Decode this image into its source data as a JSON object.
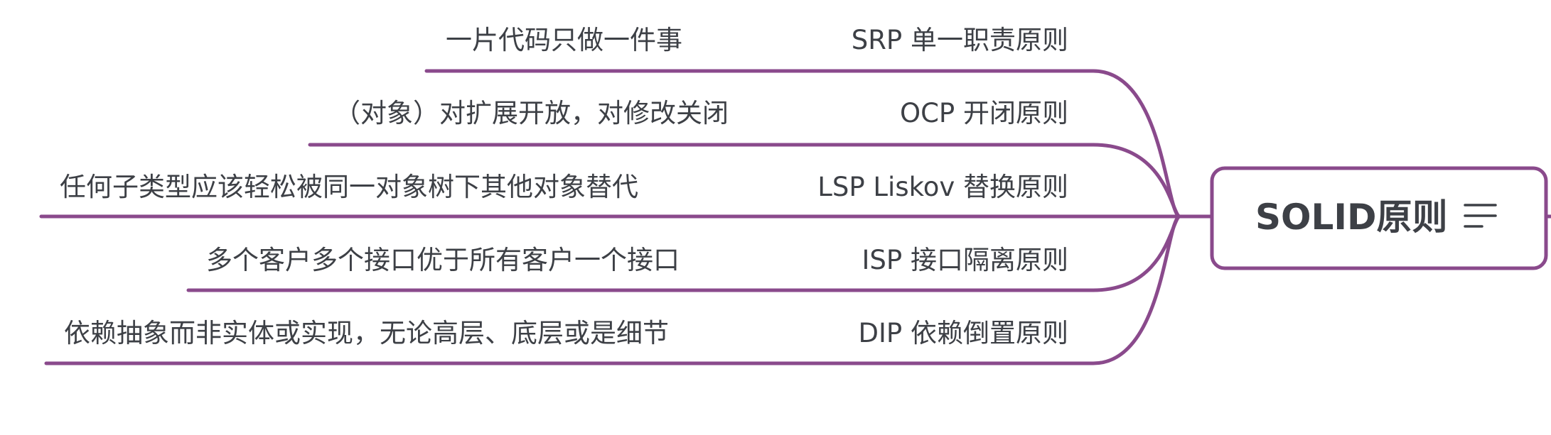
{
  "root": {
    "title": "SOLID原则",
    "icon": "notes-icon"
  },
  "colors": {
    "branch": "#8a4a8c",
    "text": "#3d4046",
    "background": "#ffffff"
  },
  "principles": [
    {
      "key": "srp",
      "name": "SRP 单一职责原则",
      "description": "一片代码只做一件事"
    },
    {
      "key": "ocp",
      "name": "OCP 开闭原则",
      "description": "（对象）对扩展开放，对修改关闭"
    },
    {
      "key": "lsp",
      "name": "LSP Liskov 替换原则",
      "description": "任何子类型应该轻松被同一对象树下其他对象替代"
    },
    {
      "key": "isp",
      "name": "ISP 接口隔离原则",
      "description": "多个客户多个接口优于所有客户一个接口"
    },
    {
      "key": "dip",
      "name": "DIP 依赖倒置原则",
      "description": "依赖抽象而非实体或实现，无论高层、底层或是细节"
    }
  ]
}
